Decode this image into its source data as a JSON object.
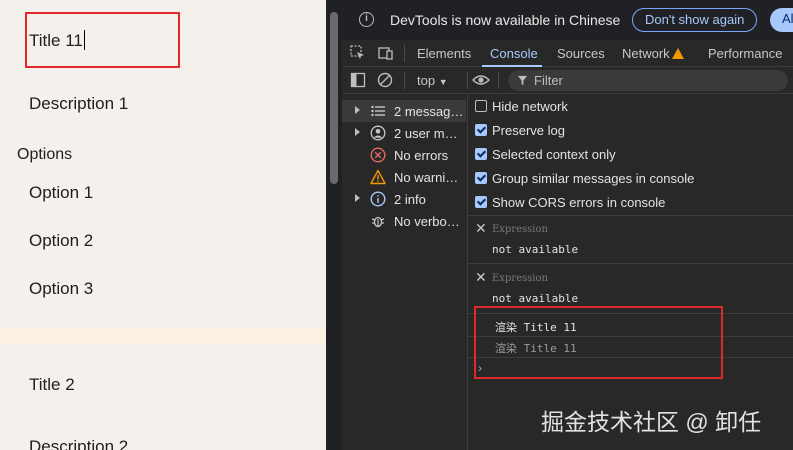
{
  "page": {
    "title_field": "Title 11",
    "description_1": "Description 1",
    "options_label": "Options",
    "options": [
      "Option 1",
      "Option 2",
      "Option 3"
    ],
    "title_2": "Title 2",
    "description_2": "Description 2"
  },
  "devtools": {
    "infobar": {
      "message": "DevTools is now available in Chinese",
      "dont_show": "Don't show again",
      "always": "Alw"
    },
    "tabs": [
      "Elements",
      "Console",
      "Sources",
      "Network",
      "Performance"
    ],
    "active_tab": "Console",
    "toolbar": {
      "context": "top",
      "filter_placeholder": "Filter"
    },
    "sidebar": [
      {
        "label": "2 messag…",
        "icon": "list-icon"
      },
      {
        "label": "2 user m…",
        "icon": "user-icon"
      },
      {
        "label": "No errors",
        "icon": "error-icon"
      },
      {
        "label": "No warni…",
        "icon": "warning-icon"
      },
      {
        "label": "2 info",
        "icon": "info-icon"
      },
      {
        "label": "No verbo…",
        "icon": "bug-icon"
      }
    ],
    "settings": [
      {
        "label": "Hide network",
        "checked": false
      },
      {
        "label": "Preserve log",
        "checked": true
      },
      {
        "label": "Selected context only",
        "checked": true
      },
      {
        "label": "Group similar messages in console",
        "checked": true
      },
      {
        "label": "Show CORS errors in console",
        "checked": true
      }
    ],
    "expressions": [
      {
        "label": "Expression",
        "value": "not available"
      },
      {
        "label": "Expression",
        "value": "not available"
      }
    ],
    "logs": [
      "渲染 Title 11",
      "渲染 Title 11"
    ],
    "prompt": "›"
  },
  "watermark": "掘金技术社区 @ 卸任",
  "colors": {
    "highlight": "#e02a2a",
    "accent": "#a8c7fa",
    "warning": "#f29900",
    "error": "#e46962"
  }
}
